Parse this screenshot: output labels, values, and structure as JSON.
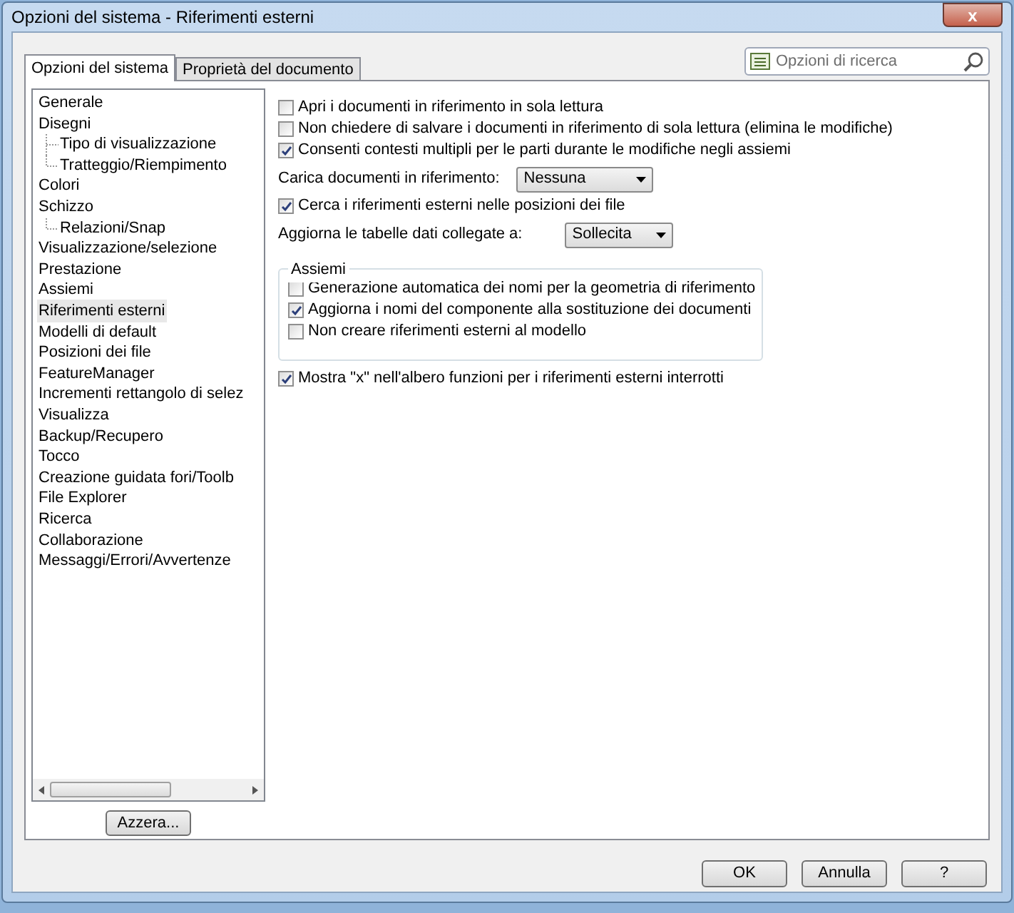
{
  "window": {
    "title": "Opzioni del sistema - Riferimenti esterni",
    "close": "x"
  },
  "tabs": [
    {
      "label": "Opzioni del sistema",
      "selected": true
    },
    {
      "label": "Proprietà del documento",
      "selected": false
    }
  ],
  "search": {
    "placeholder": "Opzioni di ricerca"
  },
  "tree": [
    {
      "label": "Generale",
      "selected": false
    },
    {
      "label": "Disegni",
      "selected": false,
      "children": [
        {
          "label": "Tipo di visualizzazione",
          "selected": false
        },
        {
          "label": "Tratteggio/Riempimento",
          "selected": false
        }
      ]
    },
    {
      "label": "Colori",
      "selected": false
    },
    {
      "label": "Schizzo",
      "selected": false,
      "children": [
        {
          "label": "Relazioni/Snap",
          "selected": false
        }
      ]
    },
    {
      "label": "Visualizzazione/selezione",
      "selected": false
    },
    {
      "label": "Prestazione",
      "selected": false
    },
    {
      "label": "Assiemi",
      "selected": false
    },
    {
      "label": "Riferimenti esterni",
      "selected": true
    },
    {
      "label": "Modelli di default",
      "selected": false
    },
    {
      "label": "Posizioni dei file",
      "selected": false
    },
    {
      "label": "FeatureManager",
      "selected": false
    },
    {
      "label": "Incrementi rettangolo di selez",
      "selected": false
    },
    {
      "label": "Visualizza",
      "selected": false
    },
    {
      "label": "Backup/Recupero",
      "selected": false
    },
    {
      "label": "Tocco",
      "selected": false
    },
    {
      "label": "Creazione guidata fori/Toolb",
      "selected": false
    },
    {
      "label": "File Explorer",
      "selected": false
    },
    {
      "label": "Ricerca",
      "selected": false
    },
    {
      "label": "Collaborazione",
      "selected": false
    },
    {
      "label": "Messaggi/Errori/Avvertenze",
      "selected": false
    }
  ],
  "reset_button": "Azzera...",
  "options": [
    {
      "kind": "checkbox",
      "label": "Apri i documenti in riferimento in sola lettura",
      "checked": false
    },
    {
      "kind": "checkbox",
      "label": "Non chiedere di salvare i documenti in riferimento di sola lettura (elimina le modifiche)",
      "checked": false
    },
    {
      "kind": "checkbox",
      "label": "Consenti contesti multipli per le parti durante le modifiche negli assiemi",
      "checked": true
    },
    {
      "kind": "dropdown",
      "label": "Carica documenti in riferimento:",
      "value": "Nessuna"
    },
    {
      "kind": "checkbox",
      "label": "Cerca i riferimenti esterni nelle posizioni dei file",
      "checked": true
    },
    {
      "kind": "dropdown",
      "label": "Aggiorna le tabelle dati collegate a:",
      "value": "Sollecita"
    },
    {
      "kind": "group",
      "label": "Assiemi",
      "items": [
        {
          "label": "Generazione automatica dei nomi per la geometria di riferimento",
          "checked": false
        },
        {
          "label": "Aggiorna i nomi del componente alla sostituzione dei documenti",
          "checked": true
        },
        {
          "label": "Non creare riferimenti esterni al modello",
          "checked": false
        }
      ]
    },
    {
      "kind": "checkbox",
      "label": "Mostra \"x\" nell'albero funzioni per i riferimenti esterni interrotti",
      "checked": true
    }
  ],
  "buttons": [
    "OK",
    "Annulla",
    "?"
  ]
}
